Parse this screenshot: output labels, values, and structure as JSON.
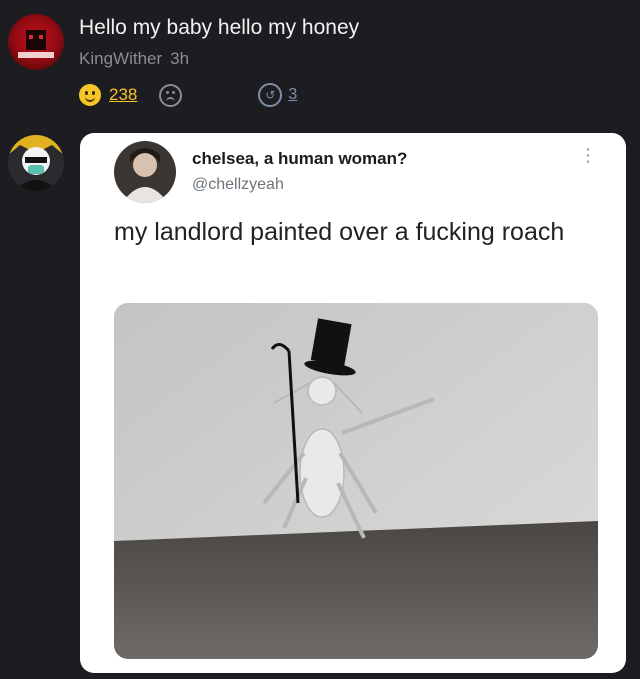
{
  "post": {
    "title": "Hello my baby hello my honey",
    "author": "KingWither",
    "time": "3h",
    "likes": "238",
    "replies": "3",
    "icons": {
      "like": "smile-icon",
      "dislike": "frown-icon",
      "reply": "reply-icon"
    }
  },
  "tweet": {
    "name": "chelsea, a human woman?",
    "handle": "@chellzyeah",
    "text": "my landlord painted over a fucking roach"
  },
  "colors": {
    "background": "#1d1c21",
    "accent": "#f7c52a",
    "reply": "#7e8fa6"
  }
}
